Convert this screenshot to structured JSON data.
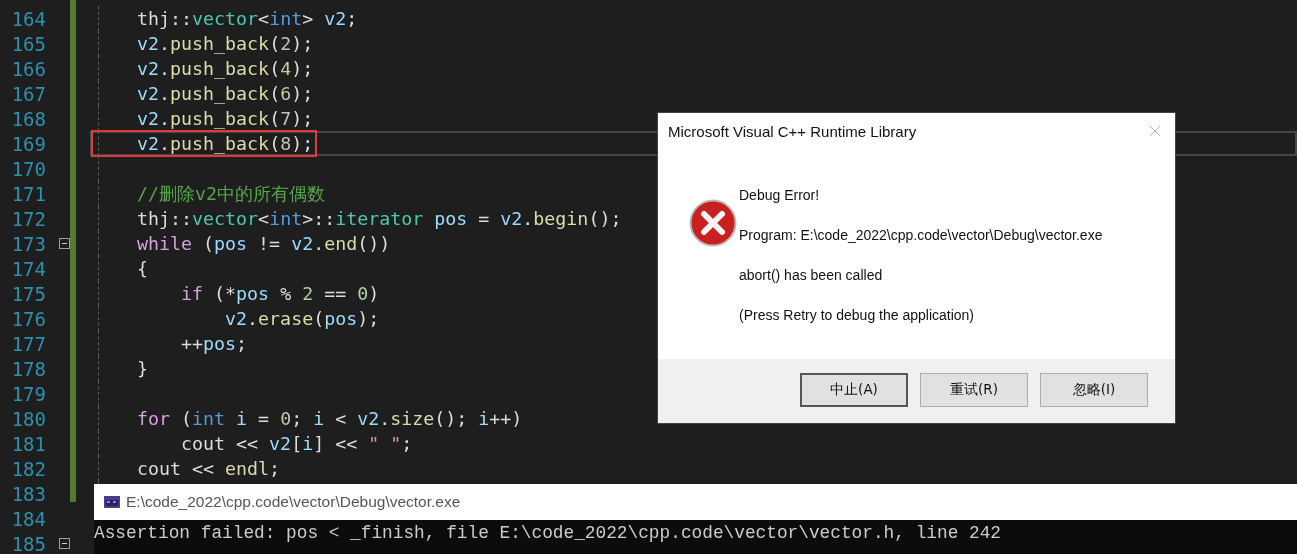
{
  "editor": {
    "lines": [
      {
        "number": "164",
        "current": false,
        "boxed": false,
        "fold": false,
        "tokens": [
          {
            "text": "    thj::",
            "kind": "plain"
          },
          {
            "text": "vector",
            "kind": "type"
          },
          {
            "text": "<",
            "kind": "plain"
          },
          {
            "text": "int",
            "kind": "keyword"
          },
          {
            "text": "> ",
            "kind": "plain"
          },
          {
            "text": "v2",
            "kind": "var"
          },
          {
            "text": ";",
            "kind": "plain"
          }
        ]
      },
      {
        "number": "165",
        "current": false,
        "boxed": false,
        "fold": false,
        "tokens": [
          {
            "text": "    v2",
            "kind": "var"
          },
          {
            "text": ".",
            "kind": "plain"
          },
          {
            "text": "push_back",
            "kind": "func"
          },
          {
            "text": "(",
            "kind": "plain"
          },
          {
            "text": "2",
            "kind": "number"
          },
          {
            "text": ");",
            "kind": "plain"
          }
        ]
      },
      {
        "number": "166",
        "current": false,
        "boxed": false,
        "fold": false,
        "tokens": [
          {
            "text": "    v2",
            "kind": "var"
          },
          {
            "text": ".",
            "kind": "plain"
          },
          {
            "text": "push_back",
            "kind": "func"
          },
          {
            "text": "(",
            "kind": "plain"
          },
          {
            "text": "4",
            "kind": "number"
          },
          {
            "text": ");",
            "kind": "plain"
          }
        ]
      },
      {
        "number": "167",
        "current": false,
        "boxed": false,
        "fold": false,
        "tokens": [
          {
            "text": "    v2",
            "kind": "var"
          },
          {
            "text": ".",
            "kind": "plain"
          },
          {
            "text": "push_back",
            "kind": "func"
          },
          {
            "text": "(",
            "kind": "plain"
          },
          {
            "text": "6",
            "kind": "number"
          },
          {
            "text": ");",
            "kind": "plain"
          }
        ]
      },
      {
        "number": "168",
        "current": false,
        "boxed": false,
        "fold": false,
        "tokens": [
          {
            "text": "    v2",
            "kind": "var"
          },
          {
            "text": ".",
            "kind": "plain"
          },
          {
            "text": "push_back",
            "kind": "func"
          },
          {
            "text": "(",
            "kind": "plain"
          },
          {
            "text": "7",
            "kind": "number"
          },
          {
            "text": ");",
            "kind": "plain"
          }
        ]
      },
      {
        "number": "169",
        "current": true,
        "boxed": true,
        "fold": false,
        "tokens": [
          {
            "text": "    v2",
            "kind": "var"
          },
          {
            "text": ".",
            "kind": "plain"
          },
          {
            "text": "push_back",
            "kind": "func"
          },
          {
            "text": "(",
            "kind": "plain"
          },
          {
            "text": "8",
            "kind": "number"
          },
          {
            "text": ");",
            "kind": "plain"
          }
        ]
      },
      {
        "number": "170",
        "current": false,
        "boxed": false,
        "fold": false
      },
      {
        "number": "171",
        "current": false,
        "boxed": false,
        "fold": false,
        "tokens": [
          {
            "text": "    //删除v2中的所有偶数",
            "kind": "comment"
          }
        ]
      },
      {
        "number": "172",
        "current": false,
        "boxed": false,
        "fold": false,
        "tokens": [
          {
            "text": "    thj::",
            "kind": "plain"
          },
          {
            "text": "vector",
            "kind": "type"
          },
          {
            "text": "<",
            "kind": "plain"
          },
          {
            "text": "int",
            "kind": "keyword"
          },
          {
            "text": ">::",
            "kind": "plain"
          },
          {
            "text": "iterator",
            "kind": "type"
          },
          {
            "text": " pos",
            "kind": "var"
          },
          {
            "text": " = ",
            "kind": "plain"
          },
          {
            "text": "v2",
            "kind": "var"
          },
          {
            "text": ".",
            "kind": "plain"
          },
          {
            "text": "begin",
            "kind": "func"
          },
          {
            "text": "();",
            "kind": "plain"
          }
        ]
      },
      {
        "number": "173",
        "current": false,
        "boxed": false,
        "fold": true,
        "tokens": [
          {
            "text": "    while",
            "kind": "control"
          },
          {
            "text": " (",
            "kind": "plain"
          },
          {
            "text": "pos",
            "kind": "var"
          },
          {
            "text": " != ",
            "kind": "plain"
          },
          {
            "text": "v2",
            "kind": "var"
          },
          {
            "text": ".",
            "kind": "plain"
          },
          {
            "text": "end",
            "kind": "func"
          },
          {
            "text": "())",
            "kind": "plain"
          }
        ]
      },
      {
        "number": "174",
        "current": false,
        "boxed": false,
        "fold": false,
        "tokens": [
          {
            "text": "    {",
            "kind": "plain"
          }
        ]
      },
      {
        "number": "175",
        "current": false,
        "boxed": false,
        "fold": false,
        "tokens": [
          {
            "text": "        if",
            "kind": "control"
          },
          {
            "text": " (*",
            "kind": "plain"
          },
          {
            "text": "pos",
            "kind": "var"
          },
          {
            "text": " % ",
            "kind": "plain"
          },
          {
            "text": "2",
            "kind": "number"
          },
          {
            "text": " == ",
            "kind": "plain"
          },
          {
            "text": "0",
            "kind": "number"
          },
          {
            "text": ")",
            "kind": "plain"
          }
        ]
      },
      {
        "number": "176",
        "current": false,
        "boxed": false,
        "fold": false,
        "tokens": [
          {
            "text": "            v2",
            "kind": "var"
          },
          {
            "text": ".",
            "kind": "plain"
          },
          {
            "text": "erase",
            "kind": "func"
          },
          {
            "text": "(",
            "kind": "plain"
          },
          {
            "text": "pos",
            "kind": "var"
          },
          {
            "text": ");",
            "kind": "plain"
          }
        ]
      },
      {
        "number": "177",
        "current": false,
        "boxed": false,
        "fold": false,
        "tokens": [
          {
            "text": "        ++",
            "kind": "plain"
          },
          {
            "text": "pos",
            "kind": "var"
          },
          {
            "text": ";",
            "kind": "plain"
          }
        ]
      },
      {
        "number": "178",
        "current": false,
        "boxed": false,
        "fold": false,
        "tokens": [
          {
            "text": "    }",
            "kind": "plain"
          }
        ]
      },
      {
        "number": "179",
        "current": false,
        "boxed": false,
        "fold": false
      },
      {
        "number": "180",
        "current": false,
        "boxed": false,
        "fold": false,
        "tokens": [
          {
            "text": "    for",
            "kind": "control"
          },
          {
            "text": " (",
            "kind": "plain"
          },
          {
            "text": "int",
            "kind": "keyword"
          },
          {
            "text": " i",
            "kind": "var"
          },
          {
            "text": " = ",
            "kind": "plain"
          },
          {
            "text": "0",
            "kind": "number"
          },
          {
            "text": "; ",
            "kind": "plain"
          },
          {
            "text": "i",
            "kind": "var"
          },
          {
            "text": " < ",
            "kind": "plain"
          },
          {
            "text": "v2",
            "kind": "var"
          },
          {
            "text": ".",
            "kind": "plain"
          },
          {
            "text": "size",
            "kind": "func"
          },
          {
            "text": "(); ",
            "kind": "plain"
          },
          {
            "text": "i",
            "kind": "var"
          },
          {
            "text": "++)",
            "kind": "plain"
          }
        ]
      },
      {
        "number": "181",
        "current": false,
        "boxed": false,
        "fold": false,
        "tokens": [
          {
            "text": "        cout << ",
            "kind": "plain"
          },
          {
            "text": "v2",
            "kind": "var"
          },
          {
            "text": "[",
            "kind": "plain"
          },
          {
            "text": "i",
            "kind": "var"
          },
          {
            "text": "] << ",
            "kind": "plain"
          },
          {
            "text": "\" \"",
            "kind": "string"
          },
          {
            "text": ";",
            "kind": "plain"
          }
        ]
      },
      {
        "number": "182",
        "current": false,
        "boxed": false,
        "fold": false,
        "tokens": [
          {
            "text": "    cout << ",
            "kind": "plain"
          },
          {
            "text": "endl",
            "kind": "func"
          },
          {
            "text": ";",
            "kind": "plain"
          }
        ]
      },
      {
        "number": "183",
        "current": false,
        "boxed": false,
        "fold": false
      },
      {
        "number": "184",
        "current": false,
        "boxed": false,
        "fold": false
      },
      {
        "number": "185",
        "current": false,
        "boxed": false,
        "fold": true
      }
    ]
  },
  "console": {
    "title": "E:\\code_2022\\cpp.code\\vector\\Debug\\vector.exe",
    "output": "Assertion failed: pos < _finish, file E:\\code_2022\\cpp.code\\vector\\vector.h, line 242"
  },
  "dialog": {
    "title": "Microsoft Visual C++ Runtime Library",
    "messages": [
      "Debug Error!",
      "Program: E:\\code_2022\\cpp.code\\vector\\Debug\\vector.exe",
      "abort() has been called",
      "(Press Retry to debug the application)"
    ],
    "buttons": [
      {
        "label": "中止(A)",
        "default": true
      },
      {
        "label": "重试(R)",
        "default": false
      },
      {
        "label": "忽略(I)",
        "default": false
      }
    ]
  }
}
